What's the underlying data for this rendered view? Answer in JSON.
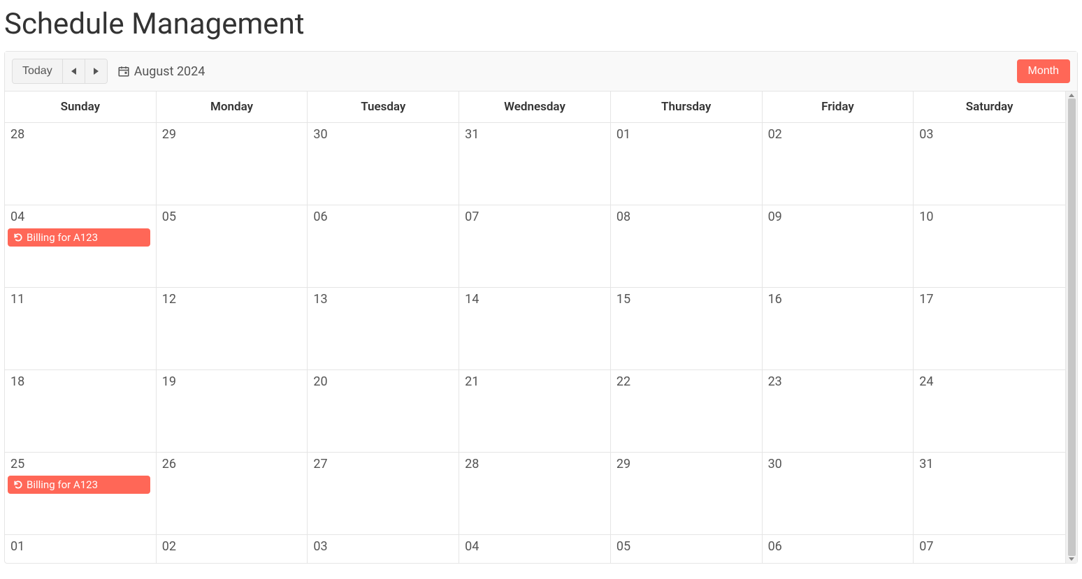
{
  "page": {
    "title": "Schedule Management"
  },
  "toolbar": {
    "today_label": "Today",
    "month_label": "August 2024",
    "view_button_label": "Month"
  },
  "weekdays": [
    "Sunday",
    "Monday",
    "Tuesday",
    "Wednesday",
    "Thursday",
    "Friday",
    "Saturday"
  ],
  "weeks": [
    [
      "28",
      "29",
      "30",
      "31",
      "01",
      "02",
      "03"
    ],
    [
      "04",
      "05",
      "06",
      "07",
      "08",
      "09",
      "10"
    ],
    [
      "11",
      "12",
      "13",
      "14",
      "15",
      "16",
      "17"
    ],
    [
      "18",
      "19",
      "20",
      "21",
      "22",
      "23",
      "24"
    ],
    [
      "25",
      "26",
      "27",
      "28",
      "29",
      "30",
      "31"
    ],
    [
      "01",
      "02",
      "03",
      "04",
      "05",
      "06",
      "07"
    ]
  ],
  "events": [
    {
      "week": 1,
      "day": 0,
      "title": "Billing for A123",
      "recurring": true
    },
    {
      "week": 4,
      "day": 0,
      "title": "Billing for A123",
      "recurring": true
    }
  ],
  "colors": {
    "accent": "#ff6757"
  }
}
